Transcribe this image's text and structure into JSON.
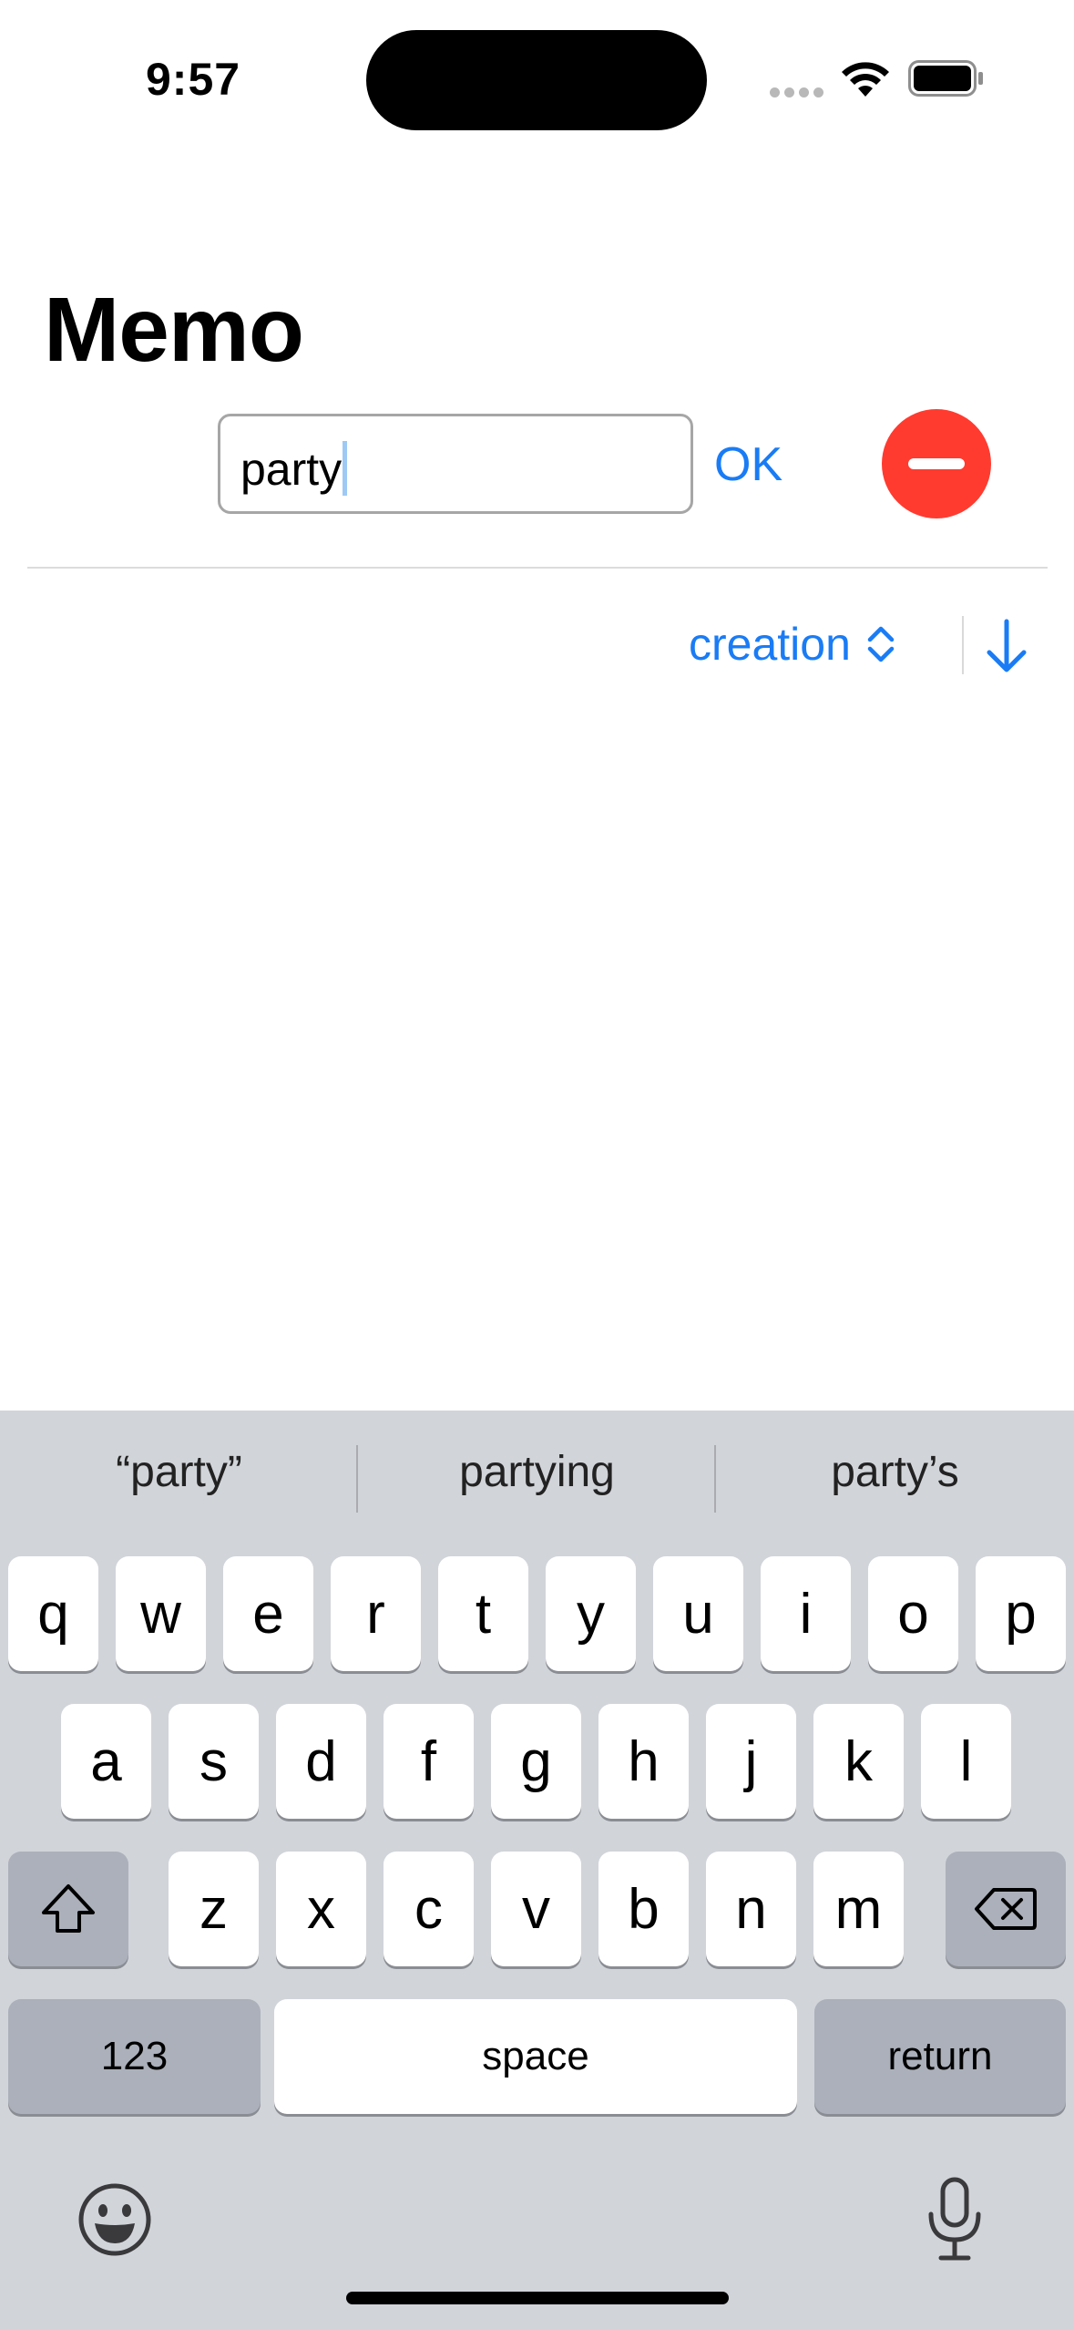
{
  "status_bar": {
    "time": "9:57"
  },
  "header": {
    "title": "Memo"
  },
  "search": {
    "value": "party",
    "ok_label": "OK"
  },
  "sort": {
    "field_label": "creation"
  },
  "keyboard": {
    "suggestions": [
      "“party”",
      "partying",
      "party’s"
    ],
    "row1": [
      "q",
      "w",
      "e",
      "r",
      "t",
      "y",
      "u",
      "i",
      "o",
      "p"
    ],
    "row2": [
      "a",
      "s",
      "d",
      "f",
      "g",
      "h",
      "j",
      "k",
      "l"
    ],
    "row3": [
      "z",
      "x",
      "c",
      "v",
      "b",
      "n",
      "m"
    ],
    "numbers_label": "123",
    "space_label": "space",
    "return_label": "return"
  },
  "icons": {
    "shift": "shift-icon",
    "backspace": "backspace-icon",
    "emoji": "emoji-icon",
    "mic": "microphone-icon",
    "wifi": "wifi-icon",
    "battery": "battery-icon",
    "sort_direction": "arrow-down-icon",
    "delete": "minus-circle-icon"
  },
  "colors": {
    "accent": "#1a7cf5",
    "destructive": "#ff3b30",
    "keyboard_bg": "#d1d4d9"
  }
}
